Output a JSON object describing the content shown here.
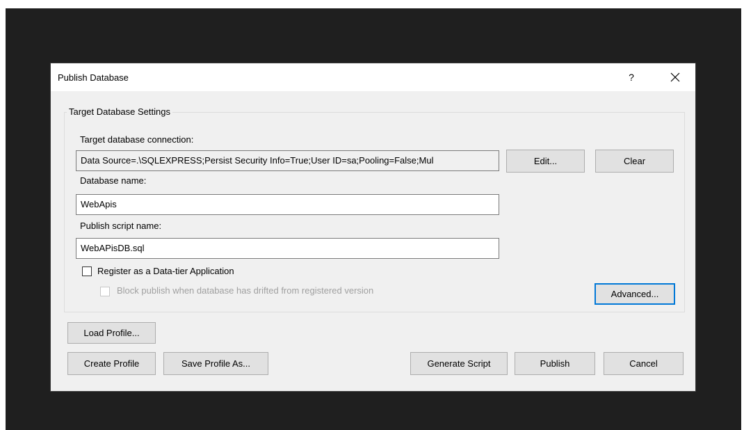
{
  "dialog": {
    "title": "Publish Database",
    "help_label": "?",
    "close_icon": "close-icon"
  },
  "group": {
    "legend": "Target Database Settings",
    "connection_label": "Target database connection:",
    "connection_value": "Data Source=.\\SQLEXPRESS;Persist Security Info=True;User ID=sa;Pooling=False;Mul",
    "edit_label": "Edit...",
    "clear_label": "Clear",
    "dbname_label": "Database name:",
    "dbname_value": "WebApis",
    "script_label": "Publish script name:",
    "script_value": "WebAPisDB.sql",
    "register_label": "Register as a Data-tier Application",
    "register_checked": false,
    "block_label": "Block publish when database has drifted from registered version",
    "block_checked": false,
    "block_enabled": false,
    "advanced_label": "Advanced..."
  },
  "footer": {
    "load_profile_label": "Load Profile...",
    "create_profile_label": "Create Profile",
    "save_profile_label": "Save Profile As...",
    "generate_script_label": "Generate Script",
    "publish_label": "Publish",
    "cancel_label": "Cancel"
  }
}
